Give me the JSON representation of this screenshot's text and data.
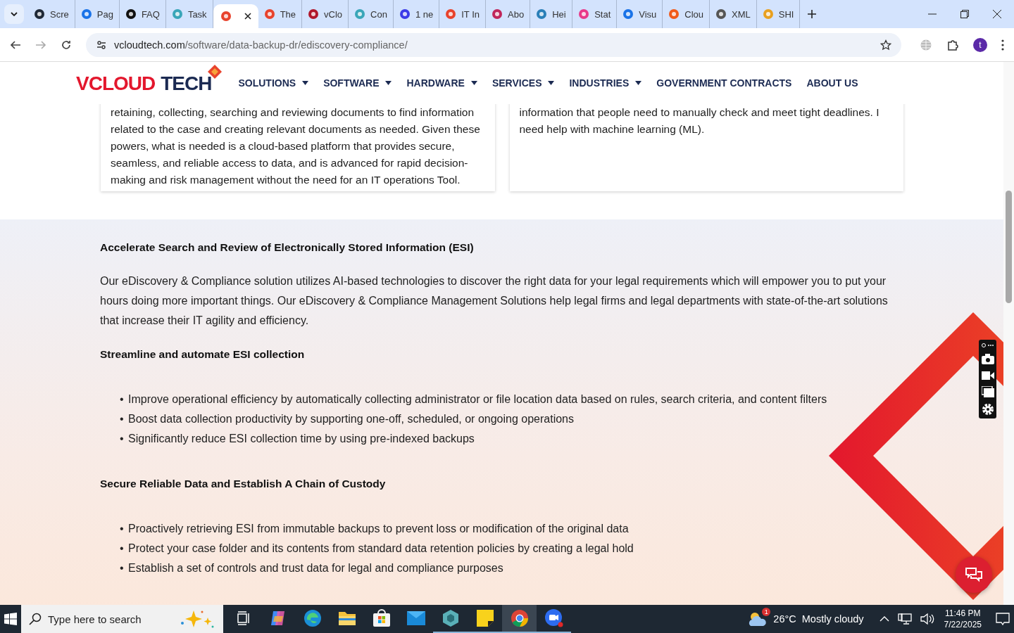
{
  "browser": {
    "tabs": [
      {
        "title": "Scre",
        "color": "#1f2937",
        "selected": false
      },
      {
        "title": "Pag",
        "color": "#1a73e8",
        "selected": false
      },
      {
        "title": "FAQ",
        "color": "#111111",
        "selected": false
      },
      {
        "title": "Task",
        "color": "#3aa6b9",
        "selected": false
      },
      {
        "color": "#e8432d",
        "selected": true
      },
      {
        "title": "The",
        "color": "#e8432d",
        "selected": false
      },
      {
        "title": "vClo",
        "color": "#b0172b",
        "selected": false
      },
      {
        "title": "Con",
        "color": "#3aa6b9",
        "selected": false
      },
      {
        "title": "1 ne",
        "color": "#3b3be8",
        "selected": false
      },
      {
        "title": "IT In",
        "color": "#e8432d",
        "selected": false
      },
      {
        "title": "Abo",
        "color": "#c0265b",
        "selected": false
      },
      {
        "title": "Hei",
        "color": "#2a7fb8",
        "selected": false
      },
      {
        "title": "Stat",
        "color": "#e83a8a",
        "selected": false
      },
      {
        "title": "Visu",
        "color": "#1a73e8",
        "selected": false
      },
      {
        "title": "Clou",
        "color": "#f05a1a",
        "selected": false
      },
      {
        "title": "XML",
        "color": "#555555",
        "selected": false
      },
      {
        "title": "SHI",
        "color": "#e8a020",
        "selected": false
      }
    ],
    "url_host": "vcloudtech.com",
    "url_path": "/software/data-backup-dr/ediscovery-compliance/",
    "profile": "t"
  },
  "site": {
    "logo_first": "VCLOUD",
    "logo_second": "TECH",
    "nav": [
      {
        "label": "SOLUTIONS",
        "has_menu": true
      },
      {
        "label": "SOFTWARE",
        "has_menu": true
      },
      {
        "label": "HARDWARE",
        "has_menu": true
      },
      {
        "label": "SERVICES",
        "has_menu": true
      },
      {
        "label": "INDUSTRIES",
        "has_menu": true
      },
      {
        "label": "GOVERNMENT CONTRACTS",
        "has_menu": false
      },
      {
        "label": "ABOUT US",
        "has_menu": false
      }
    ]
  },
  "cards": [
    "retaining, collecting, searching and reviewing documents to find information related to the case and creating relevant documents as needed. Given these powers, what is needed is a cloud-based platform that provides secure, seamless, and reliable access to data, and is advanced for rapid decision-making and risk management without the need for an IT operations Tool.",
    "information that people need to manually check and meet tight deadlines. I need help with machine learning (ML)."
  ],
  "section": {
    "heading": "Accelerate Search and Review of Electronically Stored Information (ESI)",
    "intro": "Our eDiscovery & Compliance solution utilizes AI-based technologies to discover the right data for your legal requirements which will empower you to put your hours doing more important things. Our eDiscovery & Compliance Management Solutions help legal firms and legal departments with state-of-the-art solutions that increase their IT agility and efficiency.",
    "blocks": [
      {
        "heading": "Streamline and automate ESI collection",
        "bullet": "•",
        "items": [
          "Improve operational efficiency by automatically collecting administrator or file location data based on rules, search criteria, and content filters",
          "Boost data collection productivity by supporting one-off, scheduled, or ongoing operations",
          "Significantly reduce ESI collection time by using pre-indexed backups"
        ]
      },
      {
        "heading": "Secure Reliable Data and Establish A Chain of Custody",
        "bullet": "•",
        "items": [
          "Proactively retrieving ESI from immutable backups to prevent loss or modification of the original data",
          "Protect your case folder and its contents from standard data retention policies by creating a legal hold",
          "Establish a set of controls and trust data for legal and compliance purposes"
        ]
      }
    ]
  },
  "taskbar": {
    "search_placeholder": "Type here to search",
    "apps": [
      {
        "kind": "taskview",
        "running": false,
        "selected": false
      },
      {
        "kind": "copilot",
        "running": false,
        "selected": false
      },
      {
        "kind": "edge",
        "running": false,
        "selected": false
      },
      {
        "kind": "files",
        "running": false,
        "selected": false
      },
      {
        "kind": "store",
        "running": false,
        "selected": false
      },
      {
        "kind": "mail",
        "running": false,
        "selected": false
      },
      {
        "kind": "cube",
        "running": true,
        "selected": false
      },
      {
        "kind": "notes",
        "running": true,
        "selected": false
      },
      {
        "kind": "chrome",
        "running": true,
        "selected": true
      },
      {
        "kind": "zoom",
        "running": true,
        "selected": false
      }
    ],
    "temperature": "26°C",
    "weather": "Mostly cloudy",
    "weather_badge": "1",
    "time": "11:46 PM",
    "date": "7/22/2025"
  }
}
